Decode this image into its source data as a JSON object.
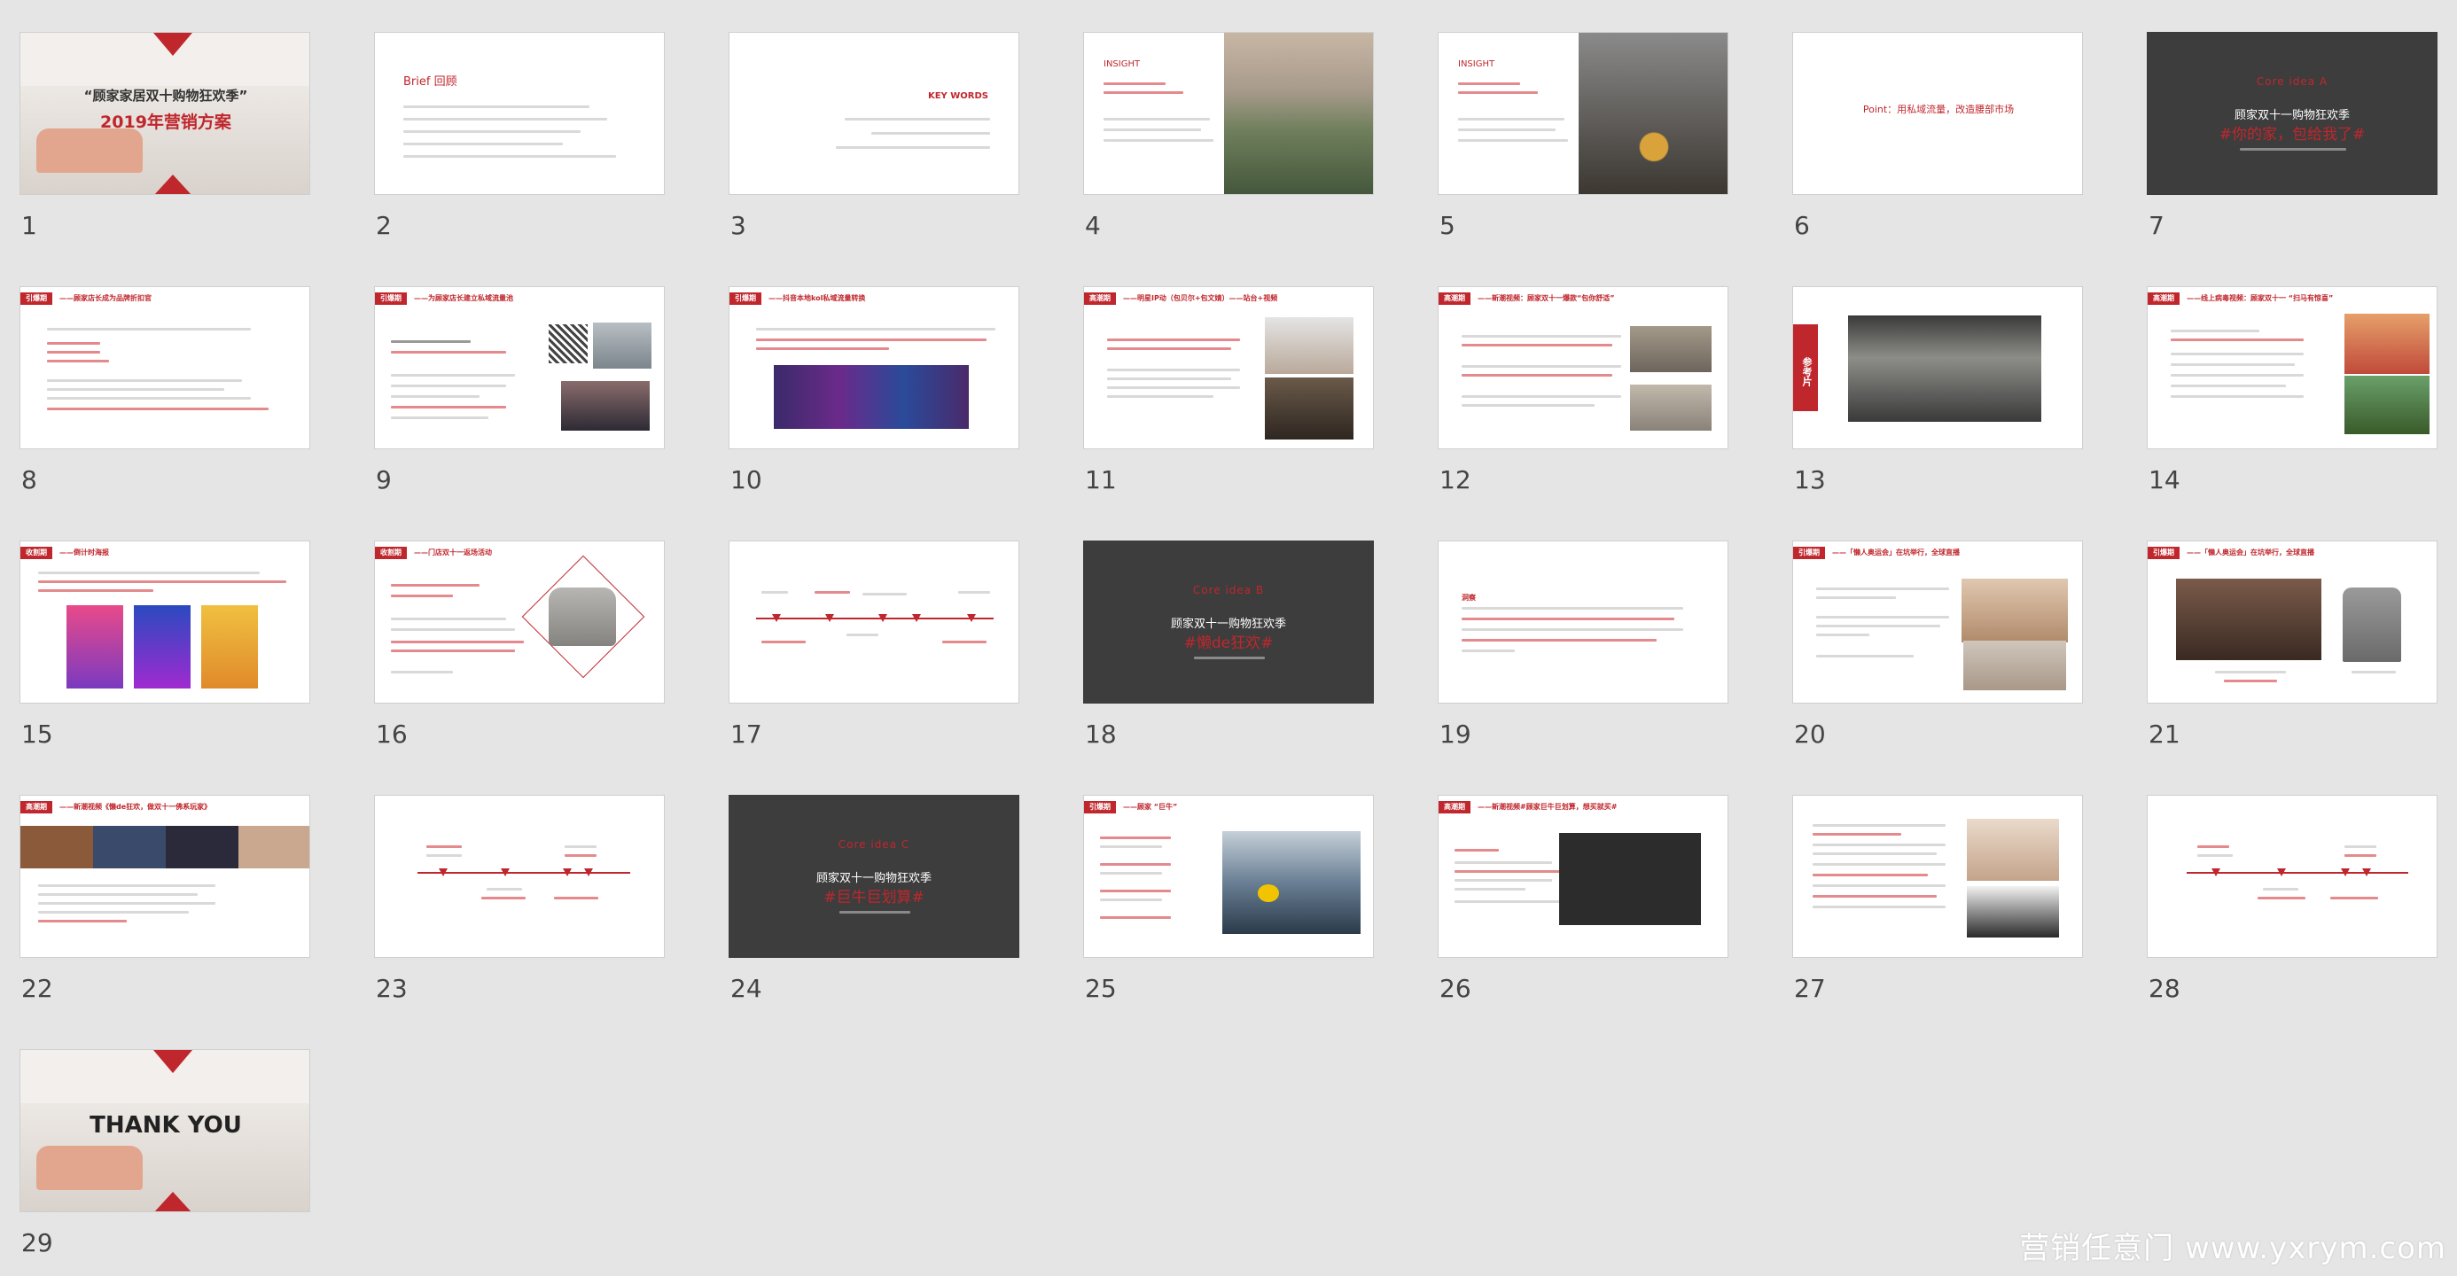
{
  "slides": [
    {
      "num": "1",
      "title": "“顾家家居双十购物狂欢季”",
      "subtitle": "2019年营销方案"
    },
    {
      "num": "2",
      "title": "Brief 回顾"
    },
    {
      "num": "3",
      "title": "KEY WORDS"
    },
    {
      "num": "4",
      "title": "INSIGHT"
    },
    {
      "num": "5",
      "title": "INSIGHT"
    },
    {
      "num": "6",
      "title": "Point：用私域流量，改造腰部市场"
    },
    {
      "num": "7",
      "core": "Core idea A",
      "line1": "顾家双十一购物狂欢季",
      "headline": "#你的家，包给我了#"
    },
    {
      "num": "8",
      "tag": "引爆期",
      "title": "——顾家店长成为品牌折扣官"
    },
    {
      "num": "9",
      "tag": "引爆期",
      "title": "——为顾家店长建立私域流量池"
    },
    {
      "num": "10",
      "tag": "引爆期",
      "title": "——抖音本地kol私域流量转换"
    },
    {
      "num": "11",
      "tag": "高潮期",
      "title": "——明星IP动（包贝尔+包文婧）——站台+视频"
    },
    {
      "num": "12",
      "tag": "高潮期",
      "title": "——新潮视频：顾家双十一爆款“包你舒适”"
    },
    {
      "num": "13",
      "side": "参考片"
    },
    {
      "num": "14",
      "tag": "高潮期",
      "title": "——线上病毒视频：顾家双十一 “扫马有惊喜”"
    },
    {
      "num": "15",
      "tag": "收割期",
      "title": "——倒计时海报"
    },
    {
      "num": "16",
      "tag": "收割期",
      "title": "——门店双十一返场活动"
    },
    {
      "num": "17"
    },
    {
      "num": "18",
      "core": "Core idea B",
      "line1": "顾家双十一购物狂欢季",
      "headline": "#懒de狂欢#"
    },
    {
      "num": "19",
      "title": "洞察"
    },
    {
      "num": "20",
      "tag": "引爆期",
      "title": "——「懒人奥运会」在坑举行，全球直播"
    },
    {
      "num": "21",
      "tag": "引爆期",
      "title": "——「懒人奥运会」在坑举行，全球直播"
    },
    {
      "num": "22",
      "tag": "高潮期",
      "title": "——新潮视频《懒de狂欢，做双十一佛系玩家》"
    },
    {
      "num": "23"
    },
    {
      "num": "24",
      "core": "Core idea C",
      "line1": "顾家双十一购物狂欢季",
      "headline": "#巨牛巨划算#"
    },
    {
      "num": "25",
      "tag": "引爆期",
      "title": "——顾家 “巨牛”"
    },
    {
      "num": "26",
      "tag": "高潮期",
      "title": "——新潮视频#顾家巨牛巨划算，想买就买#"
    },
    {
      "num": "27"
    },
    {
      "num": "28"
    },
    {
      "num": "29",
      "title": "THANK YOU"
    }
  ],
  "watermark": "营销任意门 www.yxrym.com",
  "colors": {
    "accent": "#c0272d",
    "dark": "#3d3d3d",
    "background": "#e5e5e5"
  }
}
